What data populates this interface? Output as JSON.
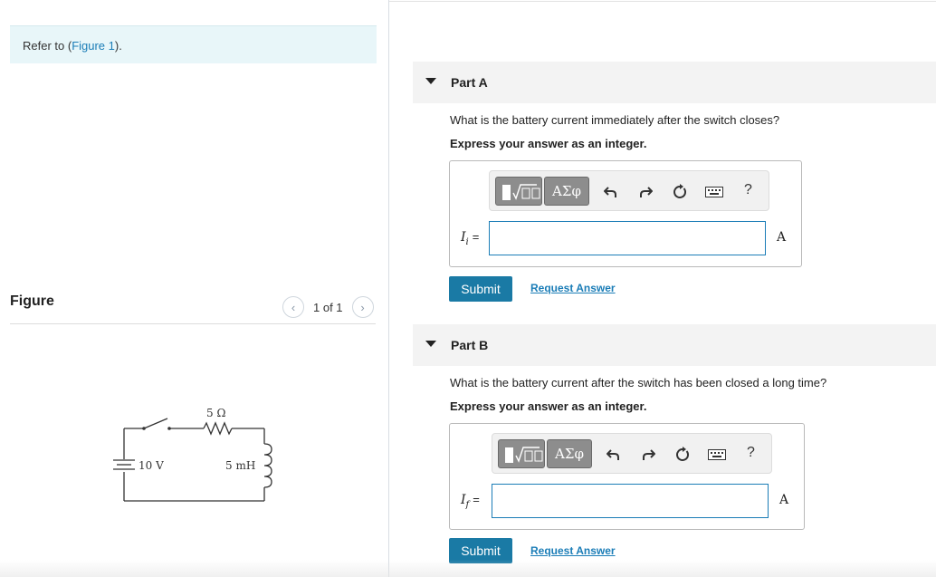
{
  "intro": {
    "prefix": "Refer to (",
    "figure_link": "Figure 1",
    "suffix": ")."
  },
  "figure": {
    "title": "Figure",
    "pager": {
      "prev_icon": "chevron-left-icon",
      "count": "1 of 1",
      "next_icon": "chevron-right-icon"
    },
    "circuit": {
      "resistor_label": "5 Ω",
      "battery_label": "10 V",
      "inductor_label": "5 mH"
    }
  },
  "toolbar": {
    "greek_label": "ΑΣφ",
    "help_label": "?",
    "icons": [
      "template-icon",
      "greek-letters-icon",
      "undo-icon",
      "redo-icon",
      "reset-icon",
      "keyboard-icon",
      "help-icon"
    ]
  },
  "parts": [
    {
      "title": "Part A",
      "question": "What is the battery current immediately after the switch closes?",
      "instruction": "Express your answer as an integer.",
      "var_symbol": "I",
      "var_subscript": "i",
      "var_eq": "=",
      "input_value": "",
      "unit": "A",
      "submit_label": "Submit",
      "request_label": "Request Answer"
    },
    {
      "title": "Part B",
      "question": "What is the battery current after the switch has been closed a long time?",
      "instruction": "Express your answer as an integer.",
      "var_symbol": "I",
      "var_subscript": "f",
      "var_eq": "=",
      "input_value": "",
      "unit": "A",
      "submit_label": "Submit",
      "request_label": "Request Answer"
    }
  ],
  "colors": {
    "accent": "#1a7aa5",
    "link": "#1b7db7",
    "intro_background": "#e8f6f9",
    "part_header_background": "#f3f3f3"
  }
}
